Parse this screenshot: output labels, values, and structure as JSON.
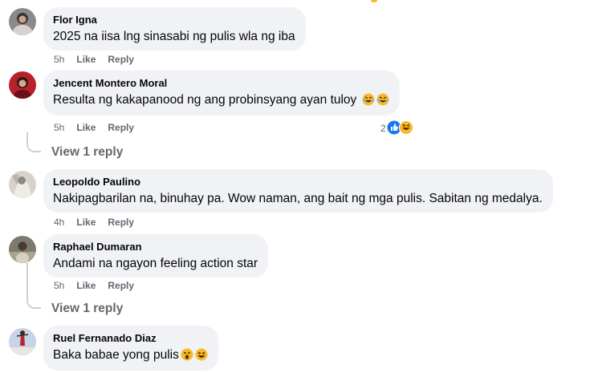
{
  "comments": [
    {
      "author": "Flor Igna",
      "text": "2025 na iisa lng sinasabi ng pulis wla ng iba",
      "time": "5h",
      "like_label": "Like",
      "reply_label": "Reply",
      "avatar_icon": "avatar-photo"
    },
    {
      "author": "Jencent Montero Moral",
      "text": "Resulta ng kakapanood ng ang probinsyang ayan tuloy",
      "emojis": [
        "rolling-on-floor-laughing-emoji",
        "rolling-on-floor-laughing-emoji"
      ],
      "time": "5h",
      "like_label": "Like",
      "reply_label": "Reply",
      "reaction_count": "2",
      "reaction_icons": [
        "like-reaction-icon",
        "haha-reaction-icon"
      ],
      "view_replies": "View 1 reply",
      "avatar_icon": "avatar-photo"
    },
    {
      "author": "Leopoldo Paulino",
      "text": "Nakipagbarilan na, binuhay pa. Wow naman, ang bait ng mga pulis. Sabitan ng medalya.",
      "time": "4h",
      "like_label": "Like",
      "reply_label": "Reply",
      "avatar_icon": "avatar-photo"
    },
    {
      "author": "Raphael Dumaran",
      "text": "Andami na ngayon feeling action star",
      "time": "5h",
      "like_label": "Like",
      "reply_label": "Reply",
      "view_replies": "View 1 reply",
      "avatar_icon": "avatar-photo"
    },
    {
      "author": "Ruel Fernanado Diaz",
      "text": "Baka babae yong pulis",
      "emojis": [
        "astonished-face-emoji",
        "grinning-squinting-face-emoji"
      ],
      "avatar_icon": "avatar-photo"
    }
  ],
  "colors": {
    "bubble": "#f0f2f5",
    "meta_text": "#65676b",
    "like_blue": "#1877f2",
    "emoji_yellow": "#f7b928"
  }
}
